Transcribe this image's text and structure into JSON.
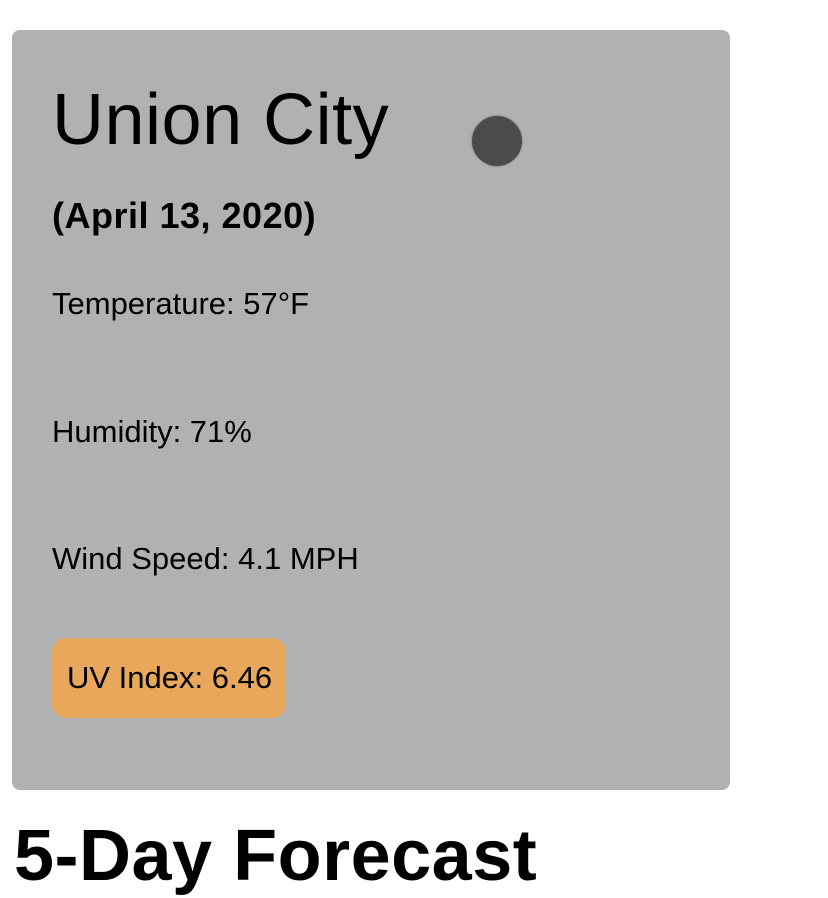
{
  "current": {
    "city": "Union City",
    "date": "(April 13, 2020)",
    "icon": "weather-icon",
    "temperature": "Temperature: 57°F",
    "humidity": "Humidity: 71%",
    "wind_speed": "Wind Speed: 4.1 MPH",
    "uv_index": "UV Index: 6.46",
    "uv_color": "#e8a75a"
  },
  "forecast": {
    "title": "5-Day Forecast"
  }
}
